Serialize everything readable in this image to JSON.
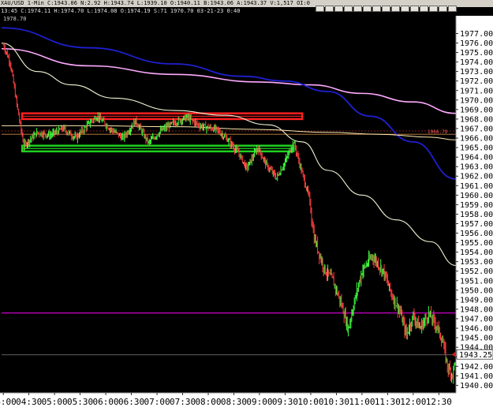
{
  "header": {
    "symbol": "XAU/USD",
    "quote_line": "XAU/USD 1-Min C:1943.06 N:2.92 H:1943.74 L:1939.10 O:1940.11 B:1943.06 A:1943.37 V:1,517 OI:0",
    "sub_line": "13:45 C:1974.11 H:1974.70 L:1974.08 O:1974.19 S:71 1970.70 03-21-23 0:40",
    "small_label": "1978.70"
  },
  "toolbar": {
    "icons": [
      "bars-icon",
      "cursor-icon",
      "line-icon",
      "arrow-icon",
      "box-icon",
      "circle-icon",
      "zoom-icon",
      "cross-icon",
      "trend-icon",
      "text-icon",
      "fib-icon",
      "delete-icon",
      "settings-icon",
      "print-icon",
      "close-icon"
    ]
  },
  "colors": {
    "background": "#000000",
    "up_candle": "#40ff40",
    "down_candle": "#ff4040",
    "blue_ma": "#1f1fd0",
    "pink_ma": "#ffaaff",
    "white_ma": "#f5f5d5",
    "cream_ma": "#ffe8b0",
    "red_zone": "#ff2020",
    "green_zone": "#20d020",
    "magenta_line": "#cc00cc",
    "gold_line": "#cc8844",
    "axis_text": "#000000",
    "axis_bg": "#ffffff"
  },
  "chart_data": {
    "type": "candlestick",
    "title": "XAU/USD 1-Min",
    "x_ticks": [
      "04:00",
      "04:30",
      "05:00",
      "05:30",
      "06:00",
      "06:30",
      "07:00",
      "07:30",
      "08:00",
      "08:30",
      "09:00",
      "09:30",
      "10:00",
      "10:30",
      "11:00",
      "11:30",
      "12:00",
      "12:30"
    ],
    "y_ticks": [
      1940,
      1941,
      1942,
      1943,
      1944,
      1945,
      1946,
      1947,
      1948,
      1949,
      1950,
      1951,
      1952,
      1953,
      1954,
      1955,
      1956,
      1957,
      1958,
      1959,
      1960,
      1961,
      1962,
      1963,
      1964,
      1965,
      1966,
      1967,
      1968,
      1969,
      1970,
      1971,
      1972,
      1973,
      1974,
      1975,
      1976,
      1977
    ],
    "y_tick_labels": [
      "1940.00",
      "1941.00",
      "1942.00",
      "1943.00",
      "1944.00",
      "1945.00",
      "1946.00",
      "1947.00",
      "1948.00",
      "1949.00",
      "1950.00",
      "1951.00",
      "1952.00",
      "1953.00",
      "1954.00",
      "1955.00",
      "1956.00",
      "1957.00",
      "1958.00",
      "1959.00",
      "1960.00",
      "1961.00",
      "1962.00",
      "1963.00",
      "1964.00",
      "1965.00",
      "1966.00",
      "1967.00",
      "1968.00",
      "1969.00",
      "1970.00",
      "1971.00",
      "1972.00",
      "1973.00",
      "1974.00",
      "1975.00",
      "1976.00",
      "1977.00"
    ],
    "ylim": [
      1939.2,
      1978.2
    ],
    "x_range_minutes": [
      -2,
      530
    ],
    "last_price_label": "1943.25",
    "last_price": 1943.25,
    "ref_line_label": "1966.79",
    "ref_line_value": 1966.75,
    "horizontal_lines": [
      {
        "name": "magenta-level",
        "value": 1947.6
      },
      {
        "name": "last-price-line",
        "value": 1943.2
      },
      {
        "name": "gold-level",
        "value": 1966.4
      }
    ],
    "zones": [
      {
        "name": "red-resistance-zone",
        "low": 1968.0,
        "high": 1968.6,
        "x_from": 0,
        "x_to": 350
      },
      {
        "name": "green-support-zone",
        "low": 1964.6,
        "high": 1965.2,
        "x_from": 0,
        "x_to": 340
      }
    ],
    "anchors": [
      [
        0,
        1975.8
      ],
      [
        8,
        1974.0
      ],
      [
        16,
        1969.5
      ],
      [
        24,
        1965.2
      ],
      [
        40,
        1966.6
      ],
      [
        55,
        1966.3
      ],
      [
        70,
        1967.0
      ],
      [
        85,
        1966.0
      ],
      [
        100,
        1967.5
      ],
      [
        110,
        1968.3
      ],
      [
        125,
        1967.0
      ],
      [
        140,
        1966.0
      ],
      [
        155,
        1967.8
      ],
      [
        170,
        1965.5
      ],
      [
        185,
        1966.8
      ],
      [
        200,
        1967.6
      ],
      [
        215,
        1968.2
      ],
      [
        230,
        1967.3
      ],
      [
        250,
        1966.9
      ],
      [
        262,
        1965.9
      ],
      [
        275,
        1964.5
      ],
      [
        285,
        1962.8
      ],
      [
        298,
        1965.0
      ],
      [
        308,
        1963.2
      ],
      [
        320,
        1961.8
      ],
      [
        330,
        1963.5
      ],
      [
        340,
        1965.6
      ],
      [
        350,
        1962.3
      ],
      [
        358,
        1959.8
      ],
      [
        364,
        1955.5
      ],
      [
        376,
        1952.2
      ],
      [
        386,
        1951.0
      ],
      [
        396,
        1948.5
      ],
      [
        404,
        1945.9
      ],
      [
        410,
        1948.4
      ],
      [
        420,
        1952.0
      ],
      [
        432,
        1953.6
      ],
      [
        445,
        1952.0
      ],
      [
        455,
        1949.5
      ],
      [
        465,
        1947.6
      ],
      [
        472,
        1945.3
      ],
      [
        480,
        1947.3
      ],
      [
        488,
        1946.0
      ],
      [
        498,
        1947.5
      ],
      [
        508,
        1946.2
      ],
      [
        515,
        1944.4
      ],
      [
        520,
        1942.0
      ],
      [
        526,
        1941.1
      ],
      [
        530,
        1943.2
      ]
    ],
    "moving_averages": [
      {
        "name": "pink-ma",
        "points": [
          [
            -2,
            1975.4
          ],
          [
            100,
            1973.6
          ],
          [
            200,
            1972.7
          ],
          [
            300,
            1971.9
          ],
          [
            360,
            1971.6
          ],
          [
            420,
            1970.7
          ],
          [
            480,
            1969.8
          ],
          [
            530,
            1968.6
          ]
        ]
      },
      {
        "name": "blue-ma",
        "points": [
          [
            -2,
            1977.6
          ],
          [
            100,
            1975.5
          ],
          [
            200,
            1973.8
          ],
          [
            280,
            1972.5
          ],
          [
            330,
            1972.0
          ],
          [
            380,
            1970.9
          ],
          [
            430,
            1968.3
          ],
          [
            480,
            1965.6
          ],
          [
            530,
            1961.7
          ]
        ]
      },
      {
        "name": "white-ma",
        "points": [
          [
            -2,
            1976.0
          ],
          [
            40,
            1973.0
          ],
          [
            80,
            1971.6
          ],
          [
            130,
            1970.2
          ],
          [
            200,
            1968.9
          ],
          [
            260,
            1968.4
          ],
          [
            310,
            1967.4
          ],
          [
            350,
            1965.6
          ],
          [
            380,
            1962.6
          ],
          [
            420,
            1960.0
          ],
          [
            460,
            1957.4
          ],
          [
            500,
            1955.1
          ],
          [
            530,
            1952.6
          ]
        ]
      },
      {
        "name": "cream-ma",
        "points": [
          [
            -2,
            1967.3
          ],
          [
            100,
            1967.3
          ],
          [
            200,
            1967.2
          ],
          [
            300,
            1966.9
          ],
          [
            380,
            1966.6
          ],
          [
            440,
            1966.4
          ],
          [
            500,
            1966.1
          ],
          [
            530,
            1965.8
          ]
        ]
      }
    ]
  }
}
